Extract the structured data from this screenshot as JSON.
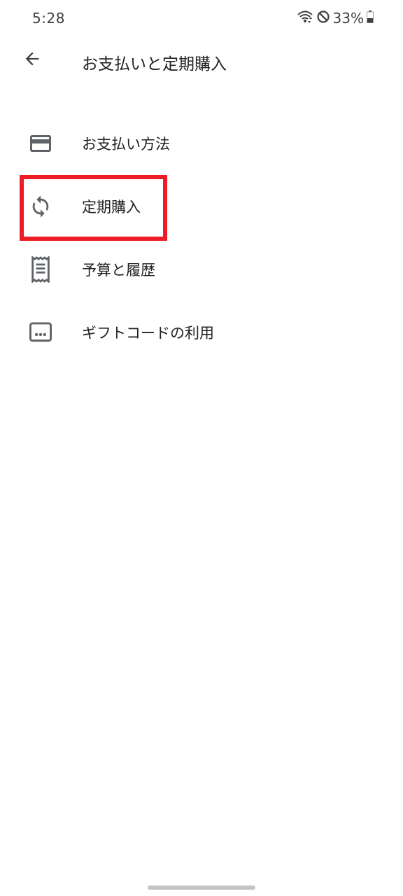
{
  "status_bar": {
    "time": "5:28",
    "battery_percent": "33%",
    "icons": [
      "wifi-icon",
      "do-not-disturb-icon",
      "battery-icon"
    ]
  },
  "app_bar": {
    "title": "お支払いと定期購入",
    "back_icon": "arrow-back-icon"
  },
  "menu": {
    "items": [
      {
        "label": "お支払い方法",
        "icon": "credit-card-icon"
      },
      {
        "label": "定期購入",
        "icon": "refresh-icon"
      },
      {
        "label": "予算と履歴",
        "icon": "receipt-icon"
      },
      {
        "label": "ギフトコードの利用",
        "icon": "gift-code-icon"
      }
    ]
  },
  "colors": {
    "highlight": "#ee1c25",
    "icon": "#5f6368",
    "text": "#202124"
  }
}
